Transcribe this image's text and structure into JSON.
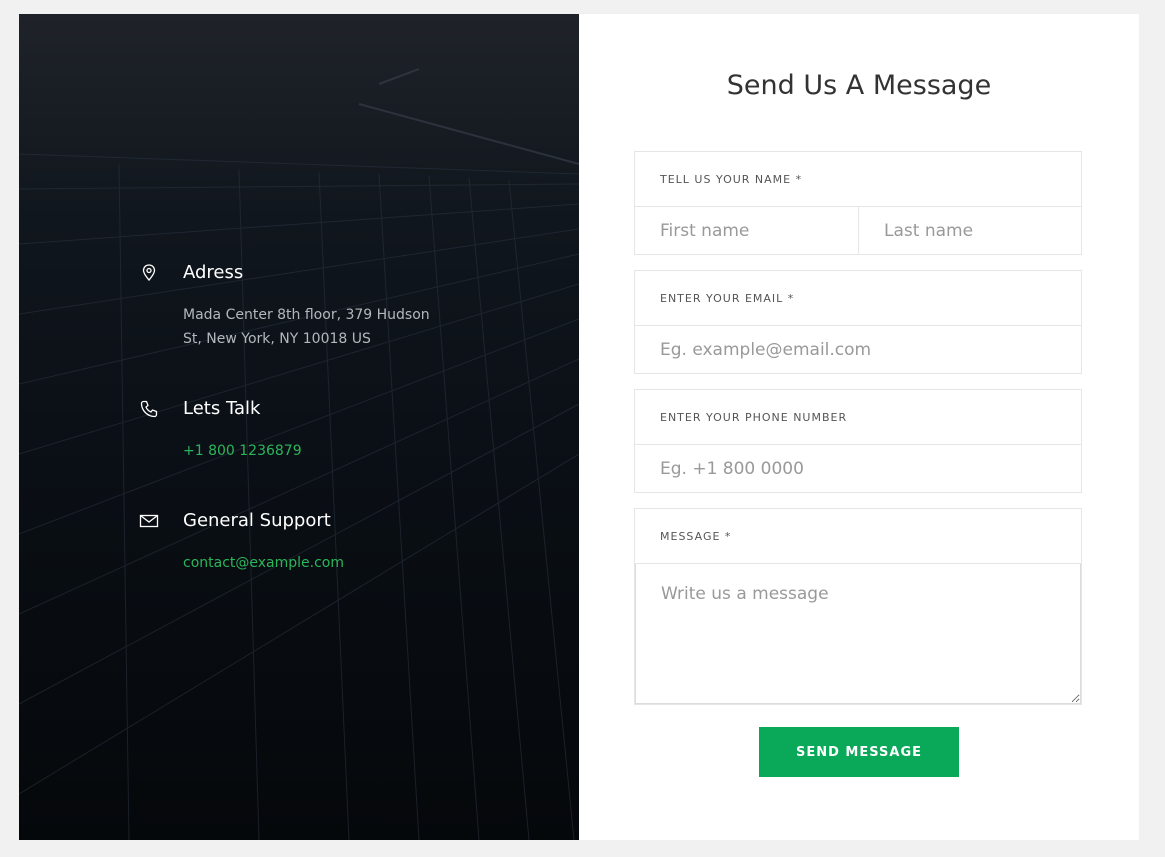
{
  "contact_info": {
    "address": {
      "icon": "map-pin-icon",
      "title": "Adress",
      "line1": "Mada Center 8th floor, 379 Hudson",
      "line2": "St, New York, NY 10018 US"
    },
    "phone": {
      "icon": "phone-icon",
      "title": "Lets Talk",
      "value": "+1 800 1236879"
    },
    "support": {
      "icon": "mail-icon",
      "title": "General Support",
      "value": "contact@example.com"
    }
  },
  "form": {
    "heading": "Send Us A Message",
    "name_label": "TELL US YOUR NAME *",
    "first_name_placeholder": "First name",
    "last_name_placeholder": "Last name",
    "email_label": "ENTER YOUR EMAIL *",
    "email_placeholder": "Eg. example@email.com",
    "phone_label": "ENTER YOUR PHONE NUMBER",
    "phone_placeholder": "Eg. +1 800 0000",
    "message_label": "MESSAGE *",
    "message_placeholder": "Write us a message",
    "submit_label": "SEND MESSAGE"
  },
  "colors": {
    "accent": "#0aa95a",
    "link_green": "#2bb55a",
    "panel_dark": "#0a0f15",
    "background": "#f1f1f1"
  }
}
